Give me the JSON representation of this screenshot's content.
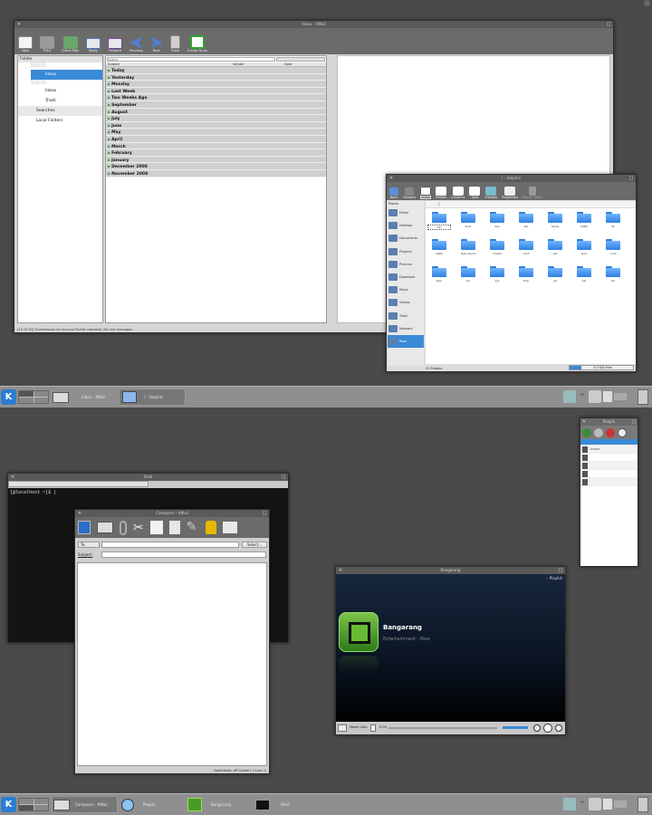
{
  "kmail_window": {
    "title": "Inbox – KMail",
    "toolbar": [
      "New",
      "Print",
      "Check Mail",
      "Reply",
      "Forward",
      "Previous",
      "Next",
      "Trash",
      "Create To-do"
    ],
    "folder_header": "Folder",
    "folders": [
      "Inbox",
      "Inbox",
      "Trash",
      "Searches",
      "Local Folders"
    ],
    "search_placeholder": "Search",
    "columns": [
      "Subject",
      "Sender",
      "Date"
    ],
    "groups": [
      "Today",
      "Yesterday",
      "Monday",
      "Last Week",
      "Two Weeks Ago",
      "September",
      "August",
      "July",
      "June",
      "May",
      "April",
      "March",
      "February",
      "January",
      "December 2008",
      "November 2008"
    ],
    "status": "[10:10:33] Transmission for account Pocket complete. No new messages."
  },
  "dolphin_window": {
    "title": "/ – Dolphin",
    "toolbar": [
      "Back",
      "Forward",
      "Icons",
      "Details",
      "Columns",
      "Split",
      "Preview",
      "Properties",
      "Empty Trash"
    ],
    "places_header": "Places",
    "places": [
      "Home",
      "Desktop",
      "Documents",
      "Projects",
      "Pictures",
      "Download",
      "Music",
      "Videos",
      "Trash",
      "Network",
      "Root"
    ],
    "path": "/",
    "folders": [
      "bin",
      "boot",
      "dev",
      "etc",
      "home",
      "lib64",
      "lib",
      "lib64",
      "lost+found",
      "media",
      "mnt",
      "opt",
      "proc",
      "root",
      "sbin",
      "srv",
      "sys",
      "tmp",
      "usr",
      "var",
      "var"
    ],
    "status_left": "21 Folders",
    "status_right": "3.0 GiB free"
  },
  "taskbar_top": {
    "tasks": [
      "Inbox – KMail",
      "/ – Dolphin"
    ]
  },
  "konsole_window": {
    "title": "Shell",
    "prompt": "[@localhost ~]$ |"
  },
  "composer_window": {
    "title": "Composer – KMail",
    "to_label": "To:",
    "select_button": "Select...",
    "subject_label": "Subject:",
    "status": "Spellcheck: off  Column: 1  Line: 1"
  },
  "people_window": {
    "title": "People",
    "contacts": [
      "",
      "Name",
      "",
      "",
      "",
      ""
    ]
  },
  "media_window": {
    "title": "Bangarang",
    "playlist_label": "Playlist",
    "media_title": "Bangarang",
    "media_subtitle": "Entertainment - Now",
    "media_lists": "Media Lists",
    "time": "0:00"
  },
  "taskbar_bottom": {
    "tasks": [
      "Composer – KMail",
      "People",
      "Bangarang",
      "Shell"
    ]
  },
  "colors": {
    "desktop": "#4a4a4a",
    "accent": "#3a8ad8",
    "group_green": "#3a9a3a"
  }
}
